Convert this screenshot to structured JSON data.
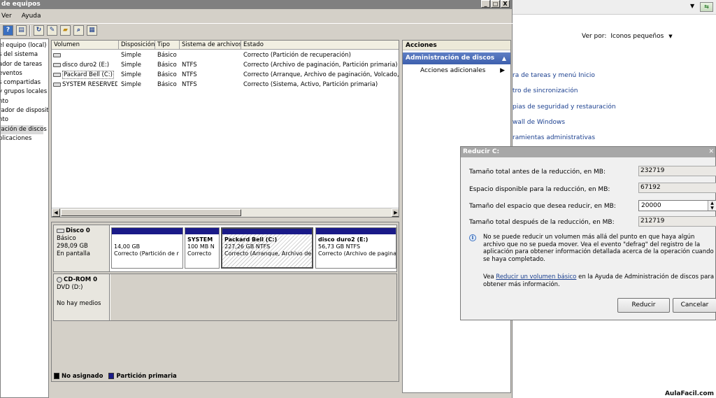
{
  "main_window": {
    "title": "de equipos",
    "title_buttons": {
      "minimize": "_",
      "maximize": "□",
      "close": "X"
    },
    "menu": [
      "Ver",
      "Ayuda"
    ]
  },
  "tree": {
    "items": [
      "el equipo (local)",
      "s del sistema",
      "ador de tareas",
      "eventos",
      "s compartidas",
      "y grupos locales",
      "nto",
      "rador de dispositiv",
      "nto",
      "ración de discos",
      "plicaciones"
    ]
  },
  "volume_list": {
    "columns": [
      "Volumen",
      "Disposición",
      "Tipo",
      "Sistema de archivos",
      "Estado"
    ],
    "rows": [
      {
        "volume": "",
        "layout": "Simple",
        "type": "Básico",
        "fs": "",
        "status": "Correcto (Partición de recuperación)"
      },
      {
        "volume": "disco duro2 (E:)",
        "layout": "Simple",
        "type": "Básico",
        "fs": "NTFS",
        "status": "Correcto (Archivo de paginación, Partición primaria)"
      },
      {
        "volume": "Packard Bell (C:)",
        "layout": "Simple",
        "type": "Básico",
        "fs": "NTFS",
        "status": "Correcto (Arranque, Archivo de paginación, Volcado, Pa"
      },
      {
        "volume": "SYSTEM RESERVED",
        "layout": "Simple",
        "type": "Básico",
        "fs": "NTFS",
        "status": "Correcto (Sistema, Activo, Partición primaria)"
      }
    ]
  },
  "disk_view": {
    "disk0": {
      "name": "Disco 0",
      "type": "Básico",
      "size": "298,09 GB",
      "status": "En pantalla",
      "partitions": [
        {
          "name": "",
          "size": "14,00 GB",
          "status": "Correcto (Partición de r"
        },
        {
          "name": "SYSTEM",
          "size": "100 MB N",
          "status": "Correcto"
        },
        {
          "name": "Packard Bell  (C:)",
          "size": "227,26 GB NTFS",
          "status": "Correcto (Arranque, Archivo de"
        },
        {
          "name": "disco duro2  (E:)",
          "size": "56,73 GB NTFS",
          "status": "Correcto (Archivo de pagina"
        }
      ]
    },
    "cdrom0": {
      "name": "CD-ROM 0",
      "drive": "DVD (D:)",
      "status": "No hay medios"
    },
    "legend": {
      "unallocated": "No asignado",
      "primary": "Partición primaria",
      "unallocated_color": "#000000",
      "primary_color": "#1a1a88"
    }
  },
  "actions": {
    "header": "Acciones",
    "section": "Administración de discos",
    "item": "Acciones adicionales"
  },
  "control_panel": {
    "view_by_label": "Ver por:",
    "view_by_value": "Iconos pequeños",
    "links": [
      "ra de tareas y menú Inicio",
      "tro de sincronización",
      "pias de seguridad y restauración",
      "wall de Windows",
      "ramientas administrativas"
    ]
  },
  "dialog": {
    "title": "Reducir C:",
    "fields": [
      {
        "label": "Tamaño total antes de la reducción, en MB:",
        "value": "232719"
      },
      {
        "label": "Espacio disponible para la reducción, en MB:",
        "value": "67192"
      },
      {
        "label": "Tamaño del espacio que desea reducir, en MB:",
        "value": "20000"
      },
      {
        "label": "Tamaño total después de la reducción, en MB:",
        "value": "212719"
      }
    ],
    "info_text": "No se puede reducir un volumen más allá del punto en que haya algún archivo que no se pueda mover. Vea el evento \"defrag\" del registro de la aplicación para obtener información detallada acerca de la operación cuando se haya completado.",
    "help_prefix": "Vea ",
    "help_link": "Reducir un volumen básico",
    "help_suffix": " en la Ayuda de Administración de discos para obtener más información.",
    "reduce_button": "Reducir",
    "cancel_button": "Cancelar"
  },
  "watermark": "AulaFacil.com"
}
